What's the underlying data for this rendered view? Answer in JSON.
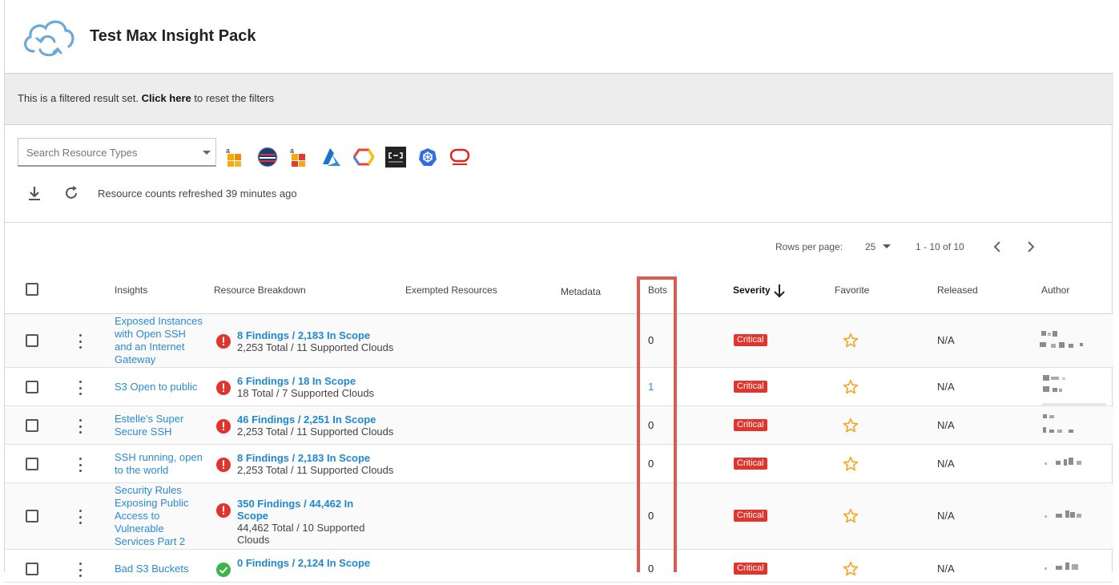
{
  "header": {
    "title": "Test Max Insight Pack",
    "logo_icon": "cloud-sync-icon"
  },
  "filter_banner": {
    "prefix": "This is a filtered result set.",
    "link": "Click here",
    "suffix": "to reset the filters"
  },
  "search": {
    "placeholder": "Search Resource Types"
  },
  "providers": [
    {
      "name": "AWS",
      "icon": "aws-icon"
    },
    {
      "name": "AWS GovCloud",
      "icon": "aws-govcloud-icon"
    },
    {
      "name": "AWS China",
      "icon": "aws-china-icon"
    },
    {
      "name": "Azure",
      "icon": "azure-icon"
    },
    {
      "name": "Google Cloud",
      "icon": "gcp-icon"
    },
    {
      "name": "Alibaba Cloud",
      "icon": "alibaba-icon"
    },
    {
      "name": "Kubernetes",
      "icon": "kubernetes-icon"
    },
    {
      "name": "Oracle",
      "icon": "oracle-icon"
    }
  ],
  "refresh": {
    "text": "Resource counts refreshed 39 minutes ago"
  },
  "pagination": {
    "rows_label": "Rows per page:",
    "rows_value": "25",
    "range": "1 - 10 of 10"
  },
  "columns": {
    "insights": "Insights",
    "breakdown": "Resource Breakdown",
    "exempted": "Exempted Resources",
    "metadata": "Metadata",
    "bots": "Bots",
    "severity": "Severity",
    "favorite": "Favorite",
    "released": "Released",
    "author": "Author"
  },
  "rows": [
    {
      "insight": "Exposed Instances with Open SSH and an Internet Gateway",
      "status": "error",
      "findings": "8 Findings / 2,183 In Scope",
      "totals": "2,253 Total / 11 Supported Clouds",
      "bots": "0",
      "severity": "Critical",
      "released": "N/A"
    },
    {
      "insight": "S3 Open to public",
      "status": "error",
      "findings": "6 Findings / 18 In Scope",
      "totals": "18 Total / 7 Supported Clouds",
      "bots": "1",
      "severity": "Critical",
      "released": "N/A"
    },
    {
      "insight": "Estelle's Super Secure SSH",
      "status": "error",
      "findings": "46 Findings / 2,251 In Scope",
      "totals": "2,253 Total / 11 Supported Clouds",
      "bots": "0",
      "severity": "Critical",
      "released": "N/A"
    },
    {
      "insight": "SSH running, open to the world",
      "status": "error",
      "findings": "8 Findings / 2,183 In Scope",
      "totals": "2,253 Total / 11 Supported Clouds",
      "bots": "0",
      "severity": "Critical",
      "released": "N/A"
    },
    {
      "insight": "Security Rules Exposing Public Access to Vulnerable Services Part 2",
      "status": "error",
      "findings": "350 Findings / 44,462 In Scope",
      "totals": "44,462 Total / 10 Supported Clouds",
      "bots": "0",
      "severity": "Critical",
      "released": "N/A"
    },
    {
      "insight": "Bad S3 Buckets",
      "status": "ok",
      "findings": "0 Findings / 2,124 In Scope",
      "totals": "",
      "bots": "0",
      "severity": "Critical",
      "released": "N/A"
    }
  ],
  "colors": {
    "link": "#2a8bd6",
    "critical": "#e0342c",
    "star": "#f5a623",
    "highlight": "#e0584f"
  }
}
